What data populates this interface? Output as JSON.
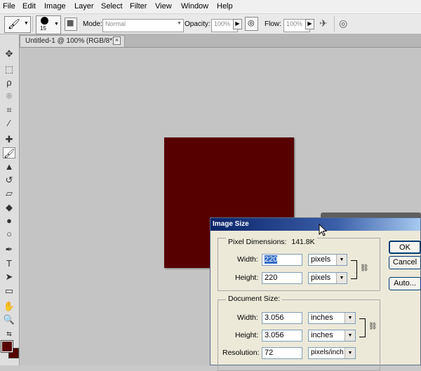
{
  "menu": [
    "File",
    "Edit",
    "Image",
    "Layer",
    "Select",
    "Filter",
    "View",
    "Window",
    "Help"
  ],
  "options": {
    "brush_size": "15",
    "mode_label": "Mode:",
    "mode_value": "Normal",
    "opacity_label": "Opacity:",
    "opacity_value": "100%",
    "flow_label": "Flow:",
    "flow_value": "100%"
  },
  "document_tab": {
    "title": "Untitled-1 @ 100% (RGB/8*)",
    "close": "×"
  },
  "colors": {
    "foreground": "#560000",
    "canvas_fill": "#560000"
  },
  "dialog": {
    "title": "Image Size",
    "pixel_dimensions_label": "Pixel Dimensions:",
    "pixel_dimensions_value": "141.8K",
    "pixel_width_label": "Width:",
    "pixel_width_value": "220",
    "pixel_width_unit": "pixels",
    "pixel_height_label": "Height:",
    "pixel_height_value": "220",
    "pixel_height_unit": "pixels",
    "document_size_label": "Document Size:",
    "doc_width_label": "Width:",
    "doc_width_value": "3.056",
    "doc_width_unit": "inches",
    "doc_height_label": "Height:",
    "doc_height_value": "3.056",
    "doc_height_unit": "inches",
    "resolution_label": "Resolution:",
    "resolution_value": "72",
    "resolution_unit": "pixels/inch",
    "ok_label": "OK",
    "cancel_label": "Cancel",
    "auto_label": "Auto..."
  }
}
